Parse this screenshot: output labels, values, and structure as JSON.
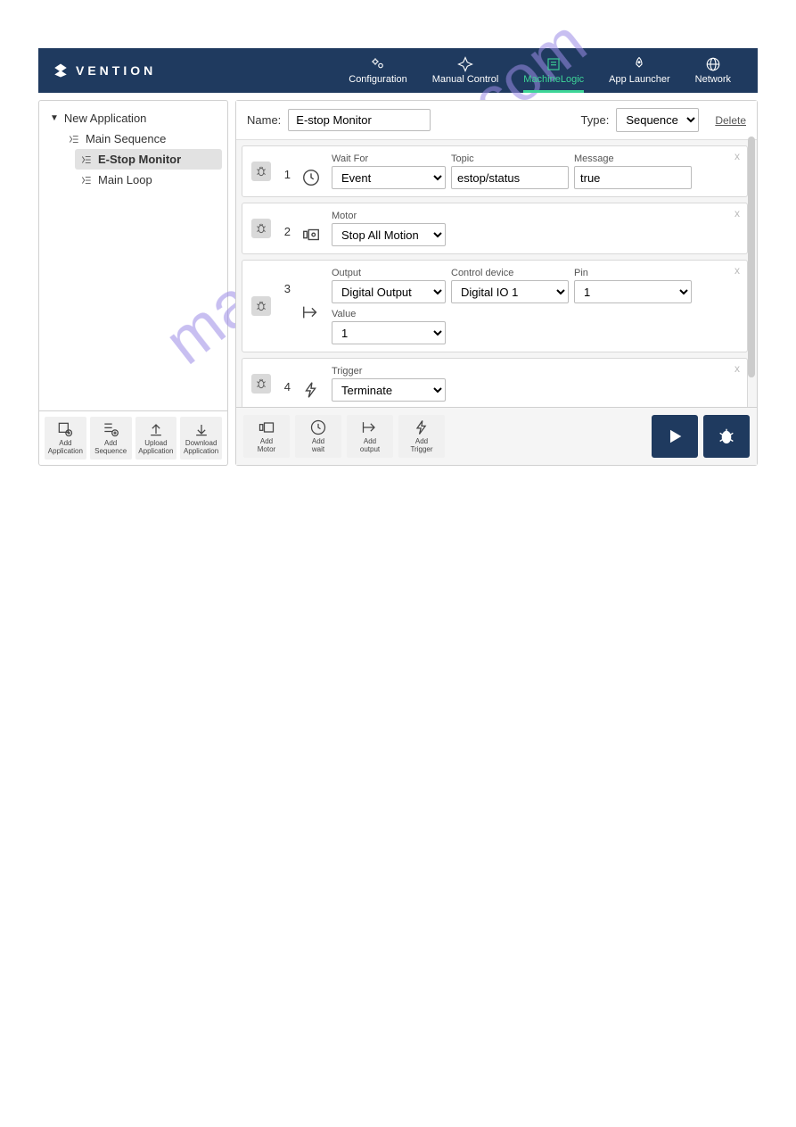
{
  "brand": "VENTION",
  "nav": {
    "configuration": "Configuration",
    "manual": "Manual Control",
    "logic": "MachineLogic",
    "launcher": "App Launcher",
    "network": "Network"
  },
  "tree": {
    "root": "New Application",
    "main_sequence": "Main Sequence",
    "estop": "E-Stop Monitor",
    "main_loop": "Main Loop"
  },
  "side_actions": {
    "add_app": "Add\nApplication",
    "add_seq": "Add\nSequence",
    "upload": "Upload\nApplication",
    "download": "Download\nApplication"
  },
  "header": {
    "name_label": "Name:",
    "name_value": "E-stop Monitor",
    "type_label": "Type:",
    "type_value": "Sequence",
    "delete": "Delete"
  },
  "steps": {
    "s1": {
      "num": "1",
      "wait_for_label": "Wait For",
      "wait_for_value": "Event",
      "topic_label": "Topic",
      "topic_value": "estop/status",
      "message_label": "Message",
      "message_value": "true"
    },
    "s2": {
      "num": "2",
      "motor_label": "Motor",
      "motor_value": "Stop All Motion"
    },
    "s3": {
      "num": "3",
      "output_label": "Output",
      "output_value": "Digital Output",
      "device_label": "Control device",
      "device_value": "Digital IO 1",
      "pin_label": "Pin",
      "pin_value": "1",
      "value_label": "Value",
      "value_value": "1"
    },
    "s4": {
      "num": "4",
      "trigger_label": "Trigger",
      "trigger_value": "Terminate"
    }
  },
  "main_actions": {
    "add_motor": "Add\nMotor",
    "add_wait": "Add\nwait",
    "add_output": "Add\noutput",
    "add_trigger": "Add\nTrigger"
  },
  "watermark": "manualshive.com"
}
